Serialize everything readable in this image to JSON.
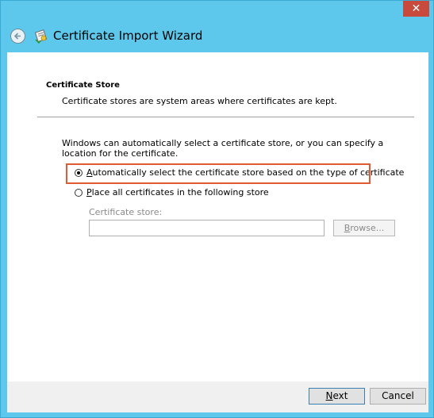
{
  "window": {
    "close_glyph": "✕",
    "title": "Certificate Import Wizard"
  },
  "section": {
    "title": "Certificate Store",
    "description": "Certificate stores are system areas where certificates are kept."
  },
  "intro_text": "Windows can automatically select a certificate store, or you can specify a location for the certificate.",
  "options": {
    "auto": {
      "mnemonic": "A",
      "label_rest": "utomatically select the certificate store based on the type of certificate",
      "selected": true
    },
    "place": {
      "mnemonic": "P",
      "label_rest": "lace all certificates in the following store",
      "selected": false
    }
  },
  "store": {
    "label": "Certificate store:",
    "value": "",
    "browse_mnemonic": "B",
    "browse_rest": "rowse..."
  },
  "footer": {
    "next_mnemonic": "N",
    "next_rest": "ext",
    "cancel_label": "Cancel"
  },
  "colors": {
    "frame": "#5ec8ec",
    "close": "#c74a3d",
    "highlight": "#e05a33"
  }
}
